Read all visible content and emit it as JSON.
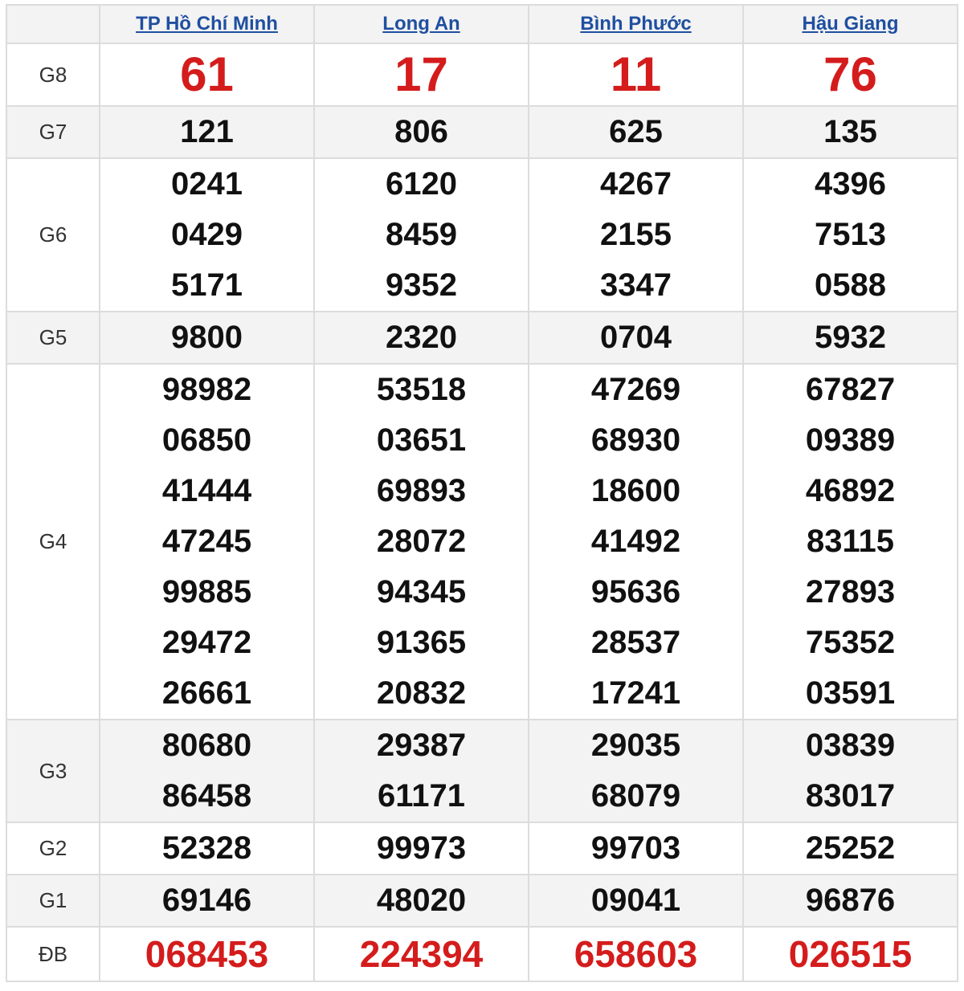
{
  "header": {
    "corner": "",
    "provinces": [
      "TP Hồ Chí Minh",
      "Long An",
      "Bình Phước",
      "Hậu Giang"
    ]
  },
  "colors": {
    "accent_red": "#d41c1c",
    "link_blue": "#1f4fa0",
    "row_shade": "#f3f3f3"
  },
  "rows": [
    {
      "label": "G8",
      "values": [
        [
          "61"
        ],
        [
          "17"
        ],
        [
          "11"
        ],
        [
          "76"
        ]
      ]
    },
    {
      "label": "G7",
      "values": [
        [
          "121"
        ],
        [
          "806"
        ],
        [
          "625"
        ],
        [
          "135"
        ]
      ]
    },
    {
      "label": "G6",
      "values": [
        [
          "0241",
          "0429",
          "5171"
        ],
        [
          "6120",
          "8459",
          "9352"
        ],
        [
          "4267",
          "2155",
          "3347"
        ],
        [
          "4396",
          "7513",
          "0588"
        ]
      ]
    },
    {
      "label": "G5",
      "values": [
        [
          "9800"
        ],
        [
          "2320"
        ],
        [
          "0704"
        ],
        [
          "5932"
        ]
      ]
    },
    {
      "label": "G4",
      "values": [
        [
          "98982",
          "06850",
          "41444",
          "47245",
          "99885",
          "29472",
          "26661"
        ],
        [
          "53518",
          "03651",
          "69893",
          "28072",
          "94345",
          "91365",
          "20832"
        ],
        [
          "47269",
          "68930",
          "18600",
          "41492",
          "95636",
          "28537",
          "17241"
        ],
        [
          "67827",
          "09389",
          "46892",
          "83115",
          "27893",
          "75352",
          "03591"
        ]
      ]
    },
    {
      "label": "G3",
      "values": [
        [
          "80680",
          "86458"
        ],
        [
          "29387",
          "61171"
        ],
        [
          "29035",
          "68079"
        ],
        [
          "03839",
          "83017"
        ]
      ]
    },
    {
      "label": "G2",
      "values": [
        [
          "52328"
        ],
        [
          "99973"
        ],
        [
          "99703"
        ],
        [
          "25252"
        ]
      ]
    },
    {
      "label": "G1",
      "values": [
        [
          "69146"
        ],
        [
          "48020"
        ],
        [
          "09041"
        ],
        [
          "96876"
        ]
      ]
    },
    {
      "label": "ĐB",
      "values": [
        [
          "068453"
        ],
        [
          "224394"
        ],
        [
          "658603"
        ],
        [
          "026515"
        ]
      ]
    }
  ]
}
